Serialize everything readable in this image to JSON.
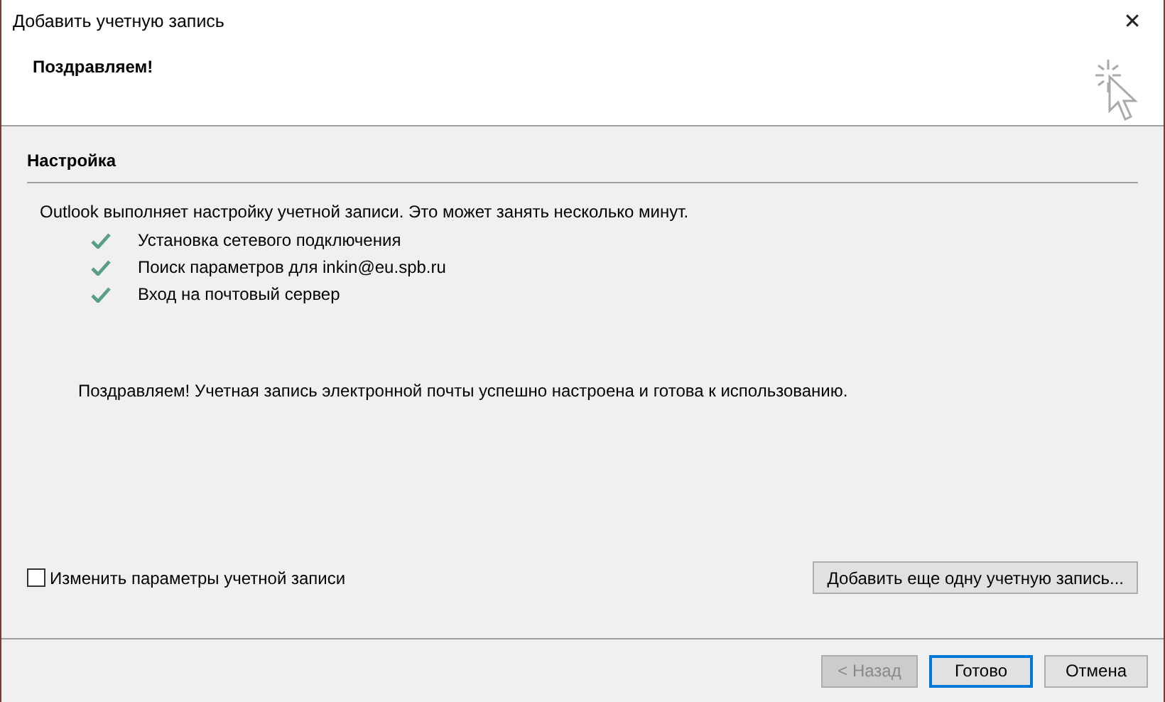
{
  "window": {
    "title": "Добавить учетную запись",
    "close": "✕"
  },
  "header": {
    "title": "Поздравляем!"
  },
  "section": {
    "title": "Настройка"
  },
  "intro": "Outlook выполняет настройку учетной записи. Это может занять несколько минут.",
  "steps": [
    {
      "label": "Установка сетевого подключения",
      "done": true
    },
    {
      "label": "Поиск параметров для inkin@eu.spb.ru",
      "done": true
    },
    {
      "label": "Вход на почтовый сервер",
      "done": true
    }
  ],
  "message": "Поздравляем! Учетная запись электронной почты успешно настроена и готова к использованию.",
  "change_settings": {
    "label": "Изменить параметры учетной записи",
    "checked": false
  },
  "add_another": "Добавить еще одну учетную запись...",
  "buttons": [
    {
      "label": "< Назад",
      "disabled": true,
      "default": false
    },
    {
      "label": "Готово",
      "disabled": false,
      "default": true
    },
    {
      "label": "Отмена",
      "disabled": false,
      "default": false
    }
  ]
}
